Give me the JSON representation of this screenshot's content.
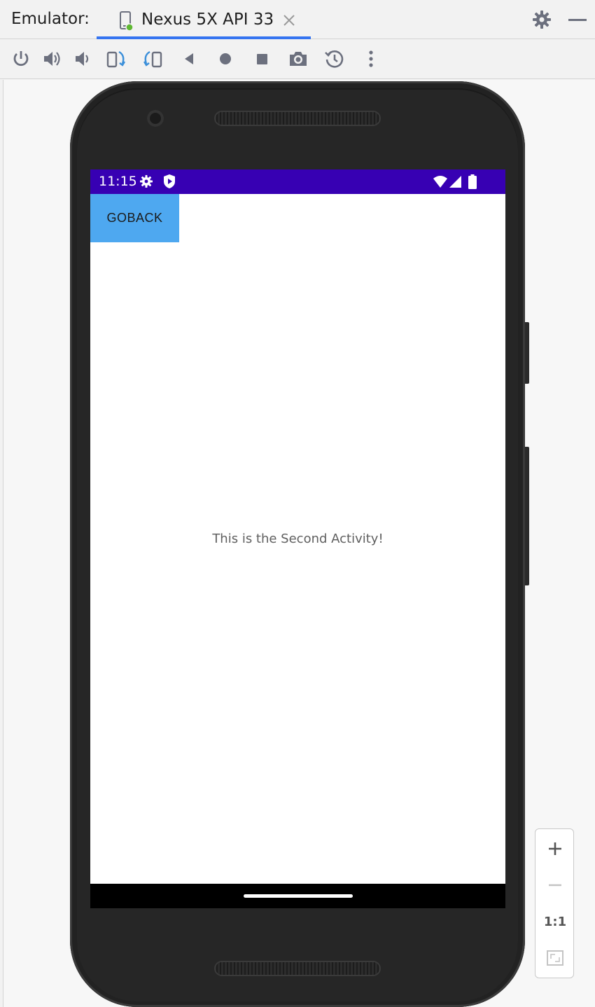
{
  "titlebar": {
    "label": "Emulator:",
    "tab_title": "Nexus 5X API 33",
    "icons": [
      "device-icon",
      "close-tab-icon",
      "settings-gear-icon",
      "minimize-icon"
    ]
  },
  "toolbar": {
    "buttons": [
      "power",
      "volume-up",
      "volume-down",
      "rotate-left",
      "rotate-right",
      "back",
      "home",
      "overview",
      "screenshot",
      "snapshot",
      "more"
    ]
  },
  "device": {
    "status_time": "11:15",
    "button_label": "GOBACK",
    "message": "This is the Second Activity!"
  },
  "zoom": {
    "one_to_one": "1:1"
  },
  "colors": {
    "status_bar": "#3700b3",
    "button": "#4ea8f0",
    "tab_underline": "#3574f0"
  }
}
